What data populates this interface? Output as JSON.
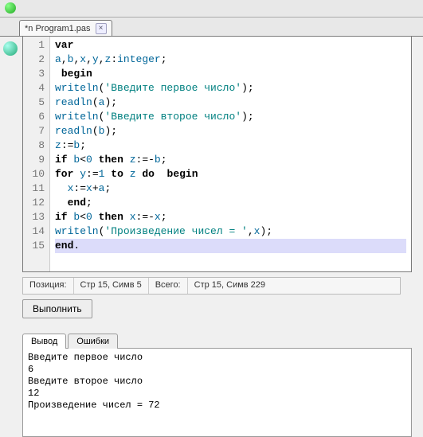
{
  "tab": {
    "label": "*n Program1.pas"
  },
  "code": {
    "lines": [
      {
        "n": "1",
        "tokens": [
          [
            "kw",
            "var"
          ]
        ]
      },
      {
        "n": "2",
        "tokens": [
          [
            "id",
            "a"
          ],
          [
            "op",
            ","
          ],
          [
            "id",
            "b"
          ],
          [
            "op",
            ","
          ],
          [
            "id",
            "x"
          ],
          [
            "op",
            ","
          ],
          [
            "id",
            "y"
          ],
          [
            "op",
            ","
          ],
          [
            "id",
            "z"
          ],
          [
            "op",
            ":"
          ],
          [
            "ty",
            "integer"
          ],
          [
            "op",
            ";"
          ]
        ]
      },
      {
        "n": "3",
        "tokens": [
          [
            "op",
            " "
          ],
          [
            "kw",
            "begin"
          ]
        ]
      },
      {
        "n": "4",
        "tokens": [
          [
            "id",
            "writeln"
          ],
          [
            "op",
            "("
          ],
          [
            "str",
            "'Введите первое число'"
          ],
          [
            "op",
            ")"
          ],
          [
            "op",
            ";"
          ]
        ]
      },
      {
        "n": "5",
        "tokens": [
          [
            "id",
            "readln"
          ],
          [
            "op",
            "("
          ],
          [
            "id",
            "a"
          ],
          [
            "op",
            ")"
          ],
          [
            "op",
            ";"
          ]
        ]
      },
      {
        "n": "6",
        "tokens": [
          [
            "id",
            "writeln"
          ],
          [
            "op",
            "("
          ],
          [
            "str",
            "'Введите второе число'"
          ],
          [
            "op",
            ")"
          ],
          [
            "op",
            ";"
          ]
        ]
      },
      {
        "n": "7",
        "tokens": [
          [
            "id",
            "readln"
          ],
          [
            "op",
            "("
          ],
          [
            "id",
            "b"
          ],
          [
            "op",
            ")"
          ],
          [
            "op",
            ";"
          ]
        ]
      },
      {
        "n": "8",
        "tokens": [
          [
            "id",
            "z"
          ],
          [
            "op",
            ":="
          ],
          [
            "id",
            "b"
          ],
          [
            "op",
            ";"
          ]
        ]
      },
      {
        "n": "9",
        "tokens": [
          [
            "kw",
            "if"
          ],
          [
            "op",
            " "
          ],
          [
            "id",
            "b"
          ],
          [
            "op",
            "<"
          ],
          [
            "num",
            "0"
          ],
          [
            "op",
            " "
          ],
          [
            "kw",
            "then"
          ],
          [
            "op",
            " "
          ],
          [
            "id",
            "z"
          ],
          [
            "op",
            ":=-"
          ],
          [
            "id",
            "b"
          ],
          [
            "op",
            ";"
          ]
        ]
      },
      {
        "n": "10",
        "tokens": [
          [
            "kw",
            "for"
          ],
          [
            "op",
            " "
          ],
          [
            "id",
            "y"
          ],
          [
            "op",
            ":="
          ],
          [
            "num",
            "1"
          ],
          [
            "op",
            " "
          ],
          [
            "kw",
            "to"
          ],
          [
            "op",
            " "
          ],
          [
            "id",
            "z"
          ],
          [
            "op",
            " "
          ],
          [
            "kw",
            "do"
          ],
          [
            "op",
            "  "
          ],
          [
            "kw",
            "begin"
          ]
        ]
      },
      {
        "n": "11",
        "tokens": [
          [
            "op",
            "  "
          ],
          [
            "id",
            "x"
          ],
          [
            "op",
            ":="
          ],
          [
            "id",
            "x"
          ],
          [
            "op",
            "+"
          ],
          [
            "id",
            "a"
          ],
          [
            "op",
            ";"
          ]
        ]
      },
      {
        "n": "12",
        "tokens": [
          [
            "op",
            "  "
          ],
          [
            "kw",
            "end"
          ],
          [
            "op",
            ";"
          ]
        ]
      },
      {
        "n": "13",
        "tokens": [
          [
            "kw",
            "if"
          ],
          [
            "op",
            " "
          ],
          [
            "id",
            "b"
          ],
          [
            "op",
            "<"
          ],
          [
            "num",
            "0"
          ],
          [
            "op",
            " "
          ],
          [
            "kw",
            "then"
          ],
          [
            "op",
            " "
          ],
          [
            "id",
            "x"
          ],
          [
            "op",
            ":=-"
          ],
          [
            "id",
            "x"
          ],
          [
            "op",
            ";"
          ]
        ]
      },
      {
        "n": "14",
        "tokens": [
          [
            "id",
            "writeln"
          ],
          [
            "op",
            "("
          ],
          [
            "str",
            "'Произведение чисел = '"
          ],
          [
            "op",
            ","
          ],
          [
            "id",
            "x"
          ],
          [
            "op",
            ")"
          ],
          [
            "op",
            ";"
          ]
        ]
      },
      {
        "n": "15",
        "tokens": [
          [
            "kw",
            "end"
          ],
          [
            "op",
            "."
          ]
        ],
        "hl": true
      }
    ]
  },
  "status": {
    "pos_label": "Позиция:",
    "pos_value": "Стр 15, Симв 5",
    "total_label": "Всего:",
    "total_value": "Стр 15, Симв 229"
  },
  "buttons": {
    "execute": "Выполнить"
  },
  "out_tabs": {
    "output": "Вывод",
    "errors": "Ошибки"
  },
  "output_text": "Введите первое число\n6\nВведите второе число\n12\nПроизведение чисел = 72"
}
